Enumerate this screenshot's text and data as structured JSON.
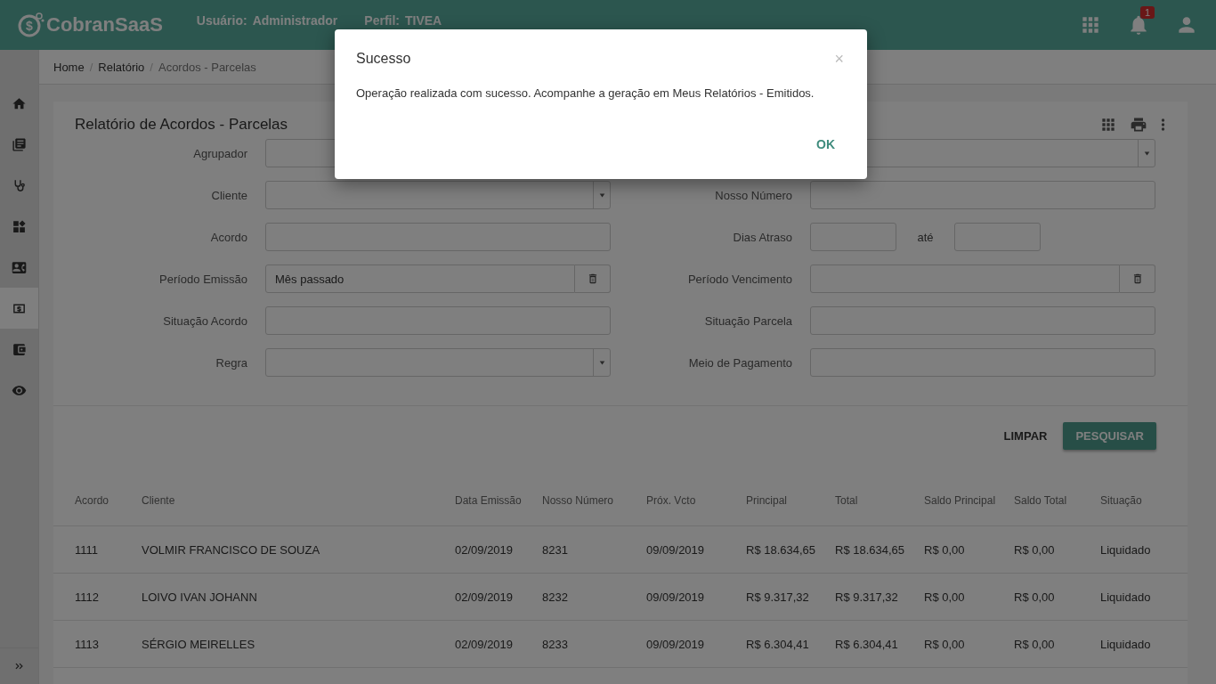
{
  "header": {
    "logo_mark": "$",
    "brand": "CobranSaaS",
    "user_label": "Usuário:",
    "user": "Administrador",
    "profile_label": "Perfil:",
    "profile": "TIVEA",
    "notification_count": "1"
  },
  "sidebar": {
    "items": [
      {
        "kind": "home",
        "selected": false
      },
      {
        "kind": "library",
        "selected": false
      },
      {
        "kind": "stethoscope",
        "selected": false
      },
      {
        "kind": "dashboard",
        "selected": false
      },
      {
        "kind": "contact",
        "selected": false
      },
      {
        "kind": "money",
        "selected": true
      },
      {
        "kind": "wallet",
        "selected": false
      },
      {
        "kind": "eye",
        "selected": false
      }
    ]
  },
  "breadcrumb": [
    "Home",
    "Relatório",
    "Acordos - Parcelas"
  ],
  "breadcrumb_separator": "/",
  "card": {
    "title": "Relatório de Acordos - Parcelas"
  },
  "filters": [
    {
      "label": "Agrupador",
      "kind": "text"
    },
    {
      "kind": "select"
    },
    {
      "label": "Cliente",
      "kind": "select"
    },
    {
      "label": "Nosso Número",
      "kind": "text"
    },
    {
      "label": "Acordo",
      "kind": "text"
    },
    {
      "label": "Dias Atraso",
      "kind": "range",
      "separator": "até"
    },
    {
      "label": "Período Emissão",
      "kind": "period",
      "value": "Mês passado"
    },
    {
      "label": "Período Vencimento",
      "kind": "period"
    },
    {
      "label": "Situação Acordo",
      "kind": "text"
    },
    {
      "label": "Situação Parcela",
      "kind": "text"
    },
    {
      "label": "Regra",
      "kind": "select"
    },
    {
      "label": "Meio de Pagamento",
      "kind": "text"
    }
  ],
  "actions": {
    "clear": "LIMPAR",
    "search": "PESQUISAR"
  },
  "table": {
    "columns": [
      "Acordo",
      "Cliente",
      "Data Emissão",
      "Nosso Número",
      "Próx. Vcto",
      "Principal",
      "Total",
      "Saldo Principal",
      "Saldo Total",
      "Situação"
    ],
    "rows": [
      [
        "1111",
        "VOLMIR FRANCISCO DE SOUZA",
        "02/09/2019",
        "8231",
        "09/09/2019",
        "R$ 18.634,65",
        "R$ 18.634,65",
        "R$ 0,00",
        "R$ 0,00",
        "Liquidado"
      ],
      [
        "1112",
        "LOIVO IVAN JOHANN",
        "02/09/2019",
        "8232",
        "09/09/2019",
        "R$ 9.317,32",
        "R$ 9.317,32",
        "R$ 0,00",
        "R$ 0,00",
        "Liquidado"
      ],
      [
        "1113",
        "SÉRGIO MEIRELLES",
        "02/09/2019",
        "8233",
        "09/09/2019",
        "R$ 6.304,41",
        "R$ 6.304,41",
        "R$ 0,00",
        "R$ 0,00",
        "Liquidado"
      ]
    ]
  },
  "dialog": {
    "title": "Sucesso",
    "close": "×",
    "message": "Operação realizada com sucesso. Acompanhe a geração em Meus Relatórios - Emitidos.",
    "button": "OK"
  }
}
